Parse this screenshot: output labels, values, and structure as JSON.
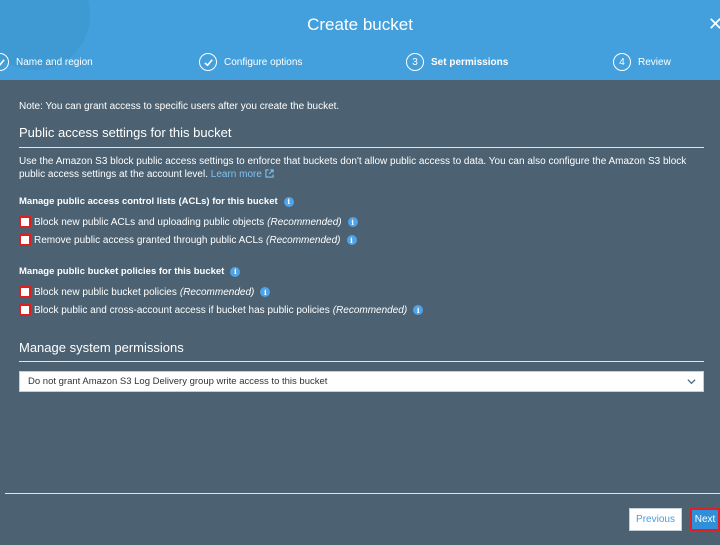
{
  "header": {
    "title": "Create bucket",
    "close_icon": "close-icon"
  },
  "steps": [
    {
      "badge": "check",
      "label": "Name and region",
      "state": "done"
    },
    {
      "badge": "check",
      "label": "Configure options",
      "state": "done"
    },
    {
      "badge": "3",
      "label": "Set permissions",
      "state": "current"
    },
    {
      "badge": "4",
      "label": "Review",
      "state": "upcoming"
    }
  ],
  "note": "Note: You can grant access to specific users after you create the bucket.",
  "public_access": {
    "title": "Public access settings for this bucket",
    "description": "Use the Amazon S3 block public access settings to enforce that buckets don't allow public access to data. You can also configure the Amazon S3 block public access settings at the account level.",
    "learn_more": "Learn more",
    "acl_group": {
      "heading": "Manage public access control lists (ACLs) for this bucket",
      "options": [
        {
          "label": "Block new public ACLs and uploading public objects",
          "recommended": "(Recommended)",
          "checked": false
        },
        {
          "label": "Remove public access granted through public ACLs",
          "recommended": "(Recommended)",
          "checked": false
        }
      ]
    },
    "policy_group": {
      "heading": "Manage public bucket policies for this bucket",
      "options": [
        {
          "label": "Block new public bucket policies",
          "recommended": "(Recommended)",
          "checked": false
        },
        {
          "label": "Block public and cross-account access if bucket has public policies",
          "recommended": "(Recommended)",
          "checked": false
        }
      ]
    }
  },
  "system_permissions": {
    "title": "Manage system permissions",
    "selected": "Do not grant Amazon S3 Log Delivery group write access to this bucket"
  },
  "footer": {
    "previous_label": "Previous",
    "next_label": "Next"
  },
  "colors": {
    "header": "#44a0dc",
    "body": "#4c6272",
    "accent": "#2f8fd8",
    "highlight": "#e02020"
  }
}
